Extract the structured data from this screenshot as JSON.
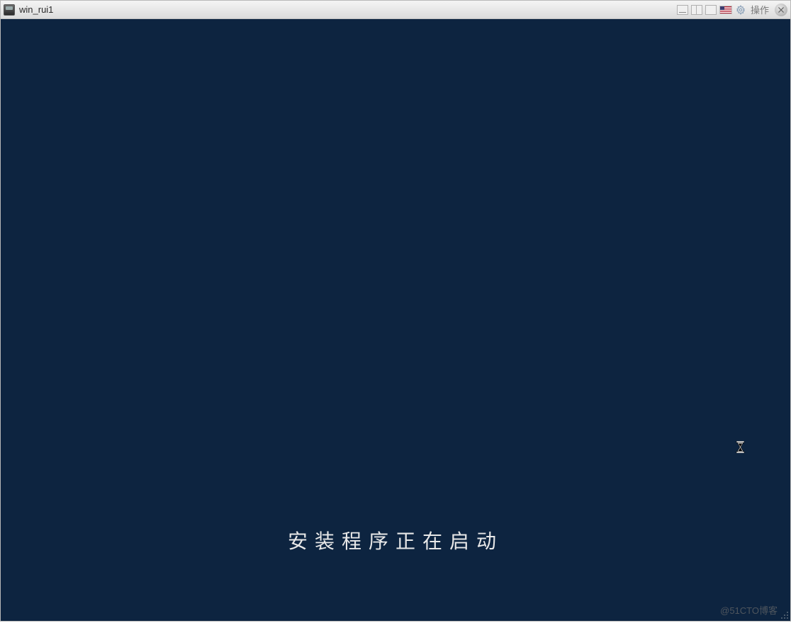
{
  "window": {
    "title": "win_rui1",
    "action_label": "操作"
  },
  "content": {
    "install_message": "安装程序正在启动"
  },
  "watermark": "@51CTO博客",
  "icons": {
    "app": "console-icon",
    "flag": "us-flag-icon",
    "gear": "gear-icon",
    "close": "close-icon",
    "cursor": "hourglass-icon",
    "grip": "resize-grip-icon"
  },
  "colors": {
    "content_bg": "#0d2440",
    "titlebar_start": "#f4f4f4",
    "titlebar_end": "#dcdcdc",
    "text": "#e8e8e8"
  }
}
